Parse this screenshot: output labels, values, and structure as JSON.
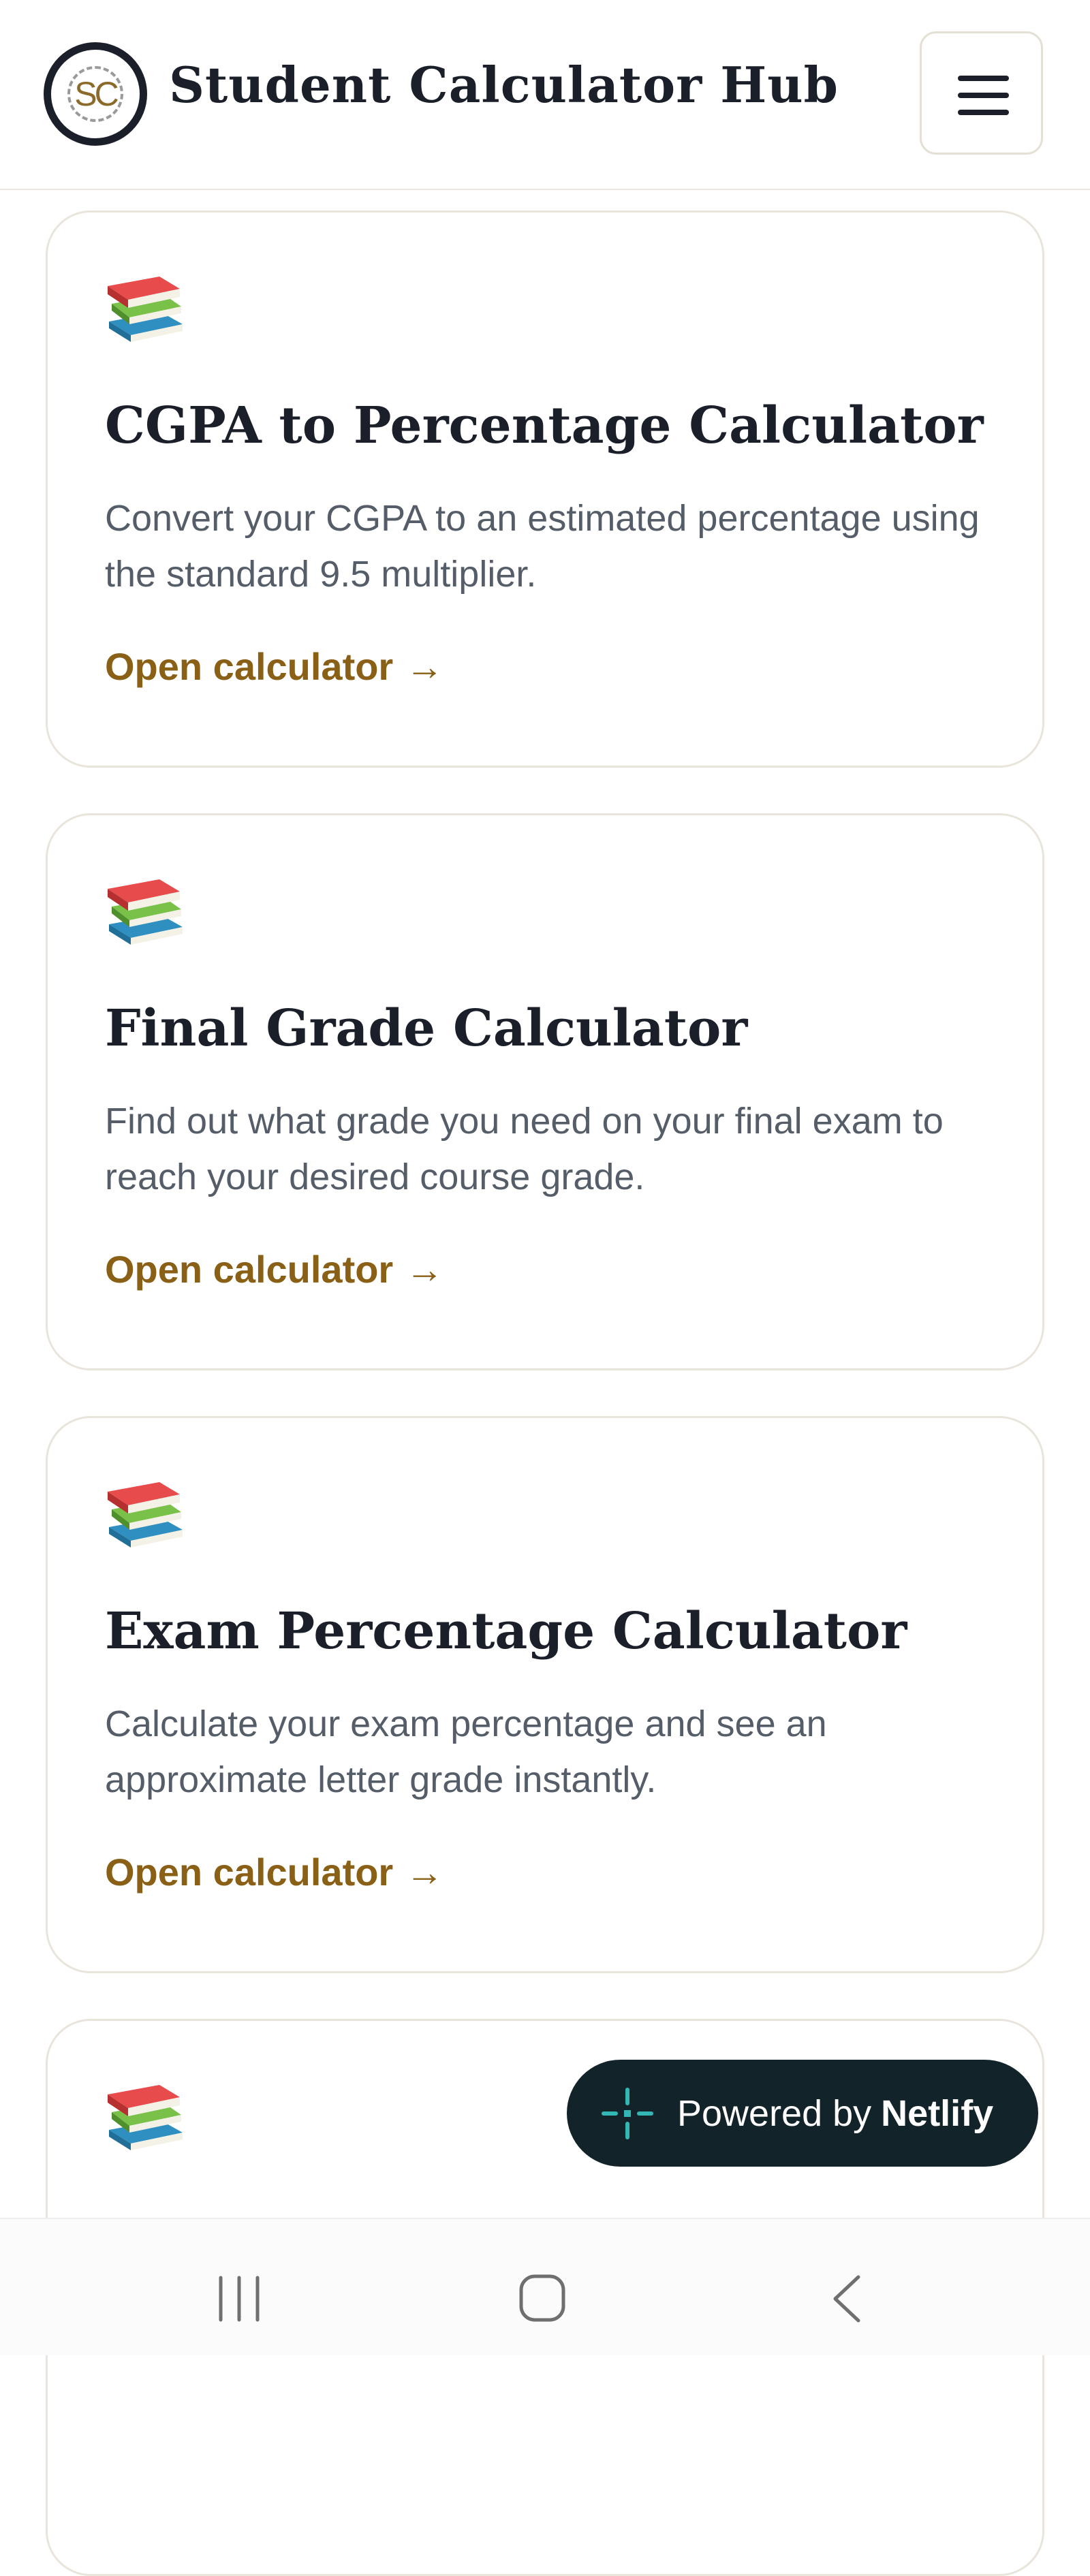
{
  "app": {
    "logo_text": "SC",
    "title": "Student Calculator Hub",
    "menu_label": "menu"
  },
  "calculators": [
    {
      "icon": "books-icon",
      "title": "CGPA to Percentage Calculator",
      "description": "Convert your CGPA to an estimated percentage using the standard 9.5 multiplier.",
      "link_label": "Open calculator",
      "link_arrow": "→"
    },
    {
      "icon": "books-icon",
      "title": "Final Grade Calculator",
      "description": "Find out what grade you need on your final exam to reach your desired course grade.",
      "link_label": "Open calculator",
      "link_arrow": "→"
    },
    {
      "icon": "books-icon",
      "title": "Exam Percentage Calculator",
      "description": "Calculate your exam percentage and see an approximate letter grade instantly.",
      "link_label": "Open calculator",
      "link_arrow": "→"
    },
    {
      "icon": "books-icon"
    }
  ],
  "badge": {
    "prefix": "Powered by",
    "brand": "Netlify",
    "icon": "netlify-icon"
  },
  "system_nav": {
    "icons": [
      "recent-apps-icon",
      "home-icon",
      "back-icon"
    ]
  },
  "colors": {
    "accent": "#8a5f16",
    "text": "#1b1f2a",
    "muted": "#555d68",
    "badge_bg": "#12242a",
    "netlify_teal": "#32b7b5"
  }
}
